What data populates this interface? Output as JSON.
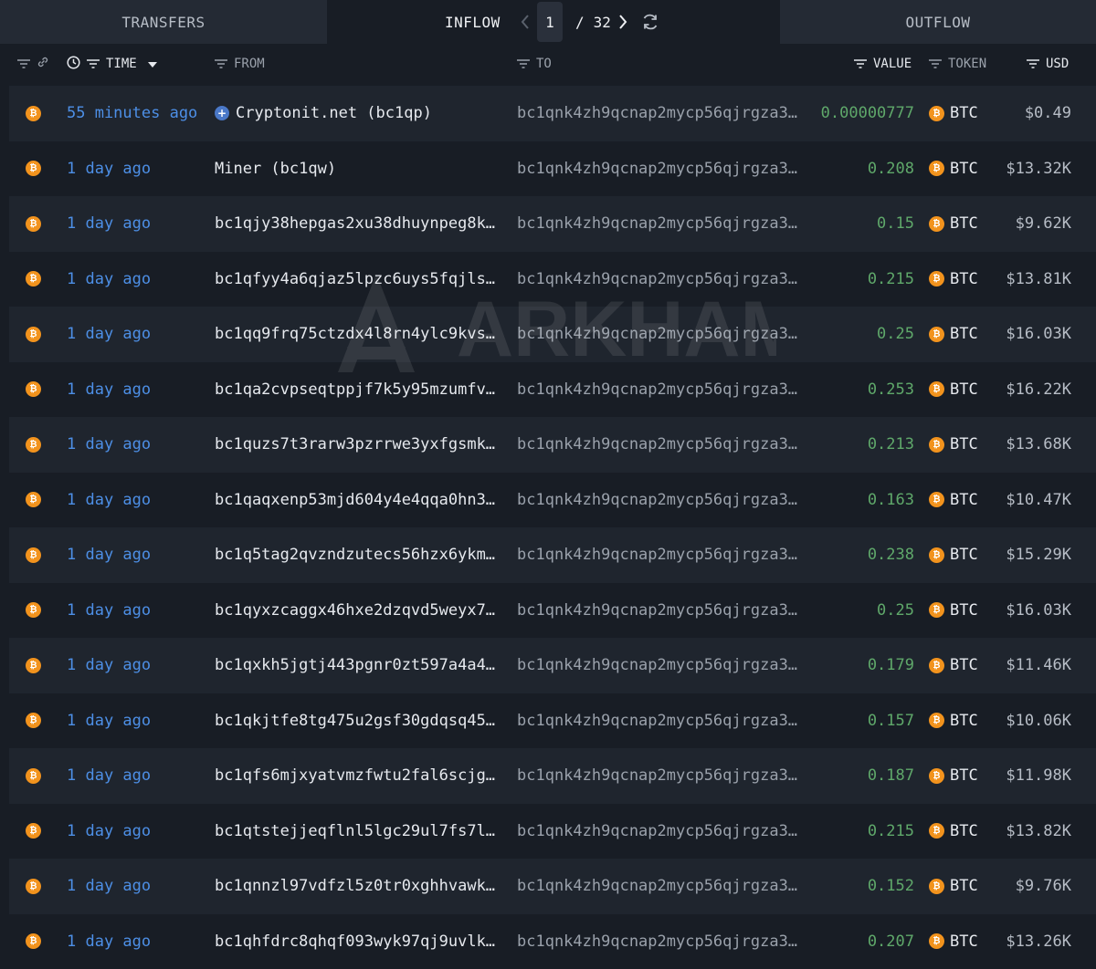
{
  "tabs": {
    "transfers": "TRANSFERS",
    "inflow": "INFLOW",
    "outflow": "OUTFLOW"
  },
  "pager": {
    "current": "1",
    "separator": "/",
    "total": "32"
  },
  "columns": {
    "time": "TIME",
    "from": "FROM",
    "to": "TO",
    "value": "VALUE",
    "token": "TOKEN",
    "usd": "USD"
  },
  "watermark": "ARKHAM",
  "rows": [
    {
      "time": "55 minutes ago",
      "from": "Cryptonit.net (bc1qp)",
      "to": "bc1qnk4zh9qcnap2mycp56qjrgza3…",
      "value": "0.00000777",
      "token": "BTC",
      "usd": "$0.49"
    },
    {
      "time": "1 day ago",
      "from": "Miner (bc1qw)",
      "to": "bc1qnk4zh9qcnap2mycp56qjrgza3…",
      "value": "0.208",
      "token": "BTC",
      "usd": "$13.32K"
    },
    {
      "time": "1 day ago",
      "from": "bc1qjy38hepgas2xu38dhuynpeg8k…",
      "to": "bc1qnk4zh9qcnap2mycp56qjrgza3…",
      "value": "0.15",
      "token": "BTC",
      "usd": "$9.62K"
    },
    {
      "time": "1 day ago",
      "from": "bc1qfyy4a6qjaz5lpzc6uys5fqjls…",
      "to": "bc1qnk4zh9qcnap2mycp56qjrgza3…",
      "value": "0.215",
      "token": "BTC",
      "usd": "$13.81K"
    },
    {
      "time": "1 day ago",
      "from": "bc1qq9frq75ctzdx4l8rn4ylc9kvs…",
      "to": "bc1qnk4zh9qcnap2mycp56qjrgza3…",
      "value": "0.25",
      "token": "BTC",
      "usd": "$16.03K"
    },
    {
      "time": "1 day ago",
      "from": "bc1qa2cvpseqtppjf7k5y95mzumfv…",
      "to": "bc1qnk4zh9qcnap2mycp56qjrgza3…",
      "value": "0.253",
      "token": "BTC",
      "usd": "$16.22K"
    },
    {
      "time": "1 day ago",
      "from": "bc1quzs7t3rarw3pzrrwe3yxfgsmk…",
      "to": "bc1qnk4zh9qcnap2mycp56qjrgza3…",
      "value": "0.213",
      "token": "BTC",
      "usd": "$13.68K"
    },
    {
      "time": "1 day ago",
      "from": "bc1qaqxenp53mjd604y4e4qqa0hn3…",
      "to": "bc1qnk4zh9qcnap2mycp56qjrgza3…",
      "value": "0.163",
      "token": "BTC",
      "usd": "$10.47K"
    },
    {
      "time": "1 day ago",
      "from": "bc1q5tag2qvzndzutecs56hzx6ykm…",
      "to": "bc1qnk4zh9qcnap2mycp56qjrgza3…",
      "value": "0.238",
      "token": "BTC",
      "usd": "$15.29K"
    },
    {
      "time": "1 day ago",
      "from": "bc1qyxzcaggx46hxe2dzqvd5weyx7…",
      "to": "bc1qnk4zh9qcnap2mycp56qjrgza3…",
      "value": "0.25",
      "token": "BTC",
      "usd": "$16.03K"
    },
    {
      "time": "1 day ago",
      "from": "bc1qxkh5jgtj443pgnr0zt597a4a4…",
      "to": "bc1qnk4zh9qcnap2mycp56qjrgza3…",
      "value": "0.179",
      "token": "BTC",
      "usd": "$11.46K"
    },
    {
      "time": "1 day ago",
      "from": "bc1qkjtfe8tg475u2gsf30gdqsq45…",
      "to": "bc1qnk4zh9qcnap2mycp56qjrgza3…",
      "value": "0.157",
      "token": "BTC",
      "usd": "$10.06K"
    },
    {
      "time": "1 day ago",
      "from": "bc1qfs6mjxyatvmzfwtu2fal6scjg…",
      "to": "bc1qnk4zh9qcnap2mycp56qjrgza3…",
      "value": "0.187",
      "token": "BTC",
      "usd": "$11.98K"
    },
    {
      "time": "1 day ago",
      "from": "bc1qtstejjeqflnl5lgc29ul7fs7l…",
      "to": "bc1qnk4zh9qcnap2mycp56qjrgza3…",
      "value": "0.215",
      "token": "BTC",
      "usd": "$13.82K"
    },
    {
      "time": "1 day ago",
      "from": "bc1qnnzl97vdfzl5z0tr0xghhvawk…",
      "to": "bc1qnk4zh9qcnap2mycp56qjrgza3…",
      "value": "0.152",
      "token": "BTC",
      "usd": "$9.76K"
    },
    {
      "time": "1 day ago",
      "from": "bc1qhfdrc8qhqf093wyk97qj9uvlk…",
      "to": "bc1qnk4zh9qcnap2mycp56qjrgza3…",
      "value": "0.207",
      "token": "BTC",
      "usd": "$13.26K"
    }
  ],
  "colors": {
    "background": "#181d25",
    "row_alt": "#1f252e",
    "tab_bg": "#242a34",
    "time_link": "#4d8fe6",
    "value_green": "#5fa86a",
    "btc_orange": "#f2931d"
  },
  "icons": {
    "filter": "filter-icon",
    "link": "link-icon",
    "clock": "clock-icon",
    "sort": "caret-down-icon",
    "prev": "chevron-left-icon",
    "next": "chevron-right-icon",
    "refresh": "refresh-icon",
    "chain": "bitcoin-icon",
    "entity": "entity-icon"
  }
}
